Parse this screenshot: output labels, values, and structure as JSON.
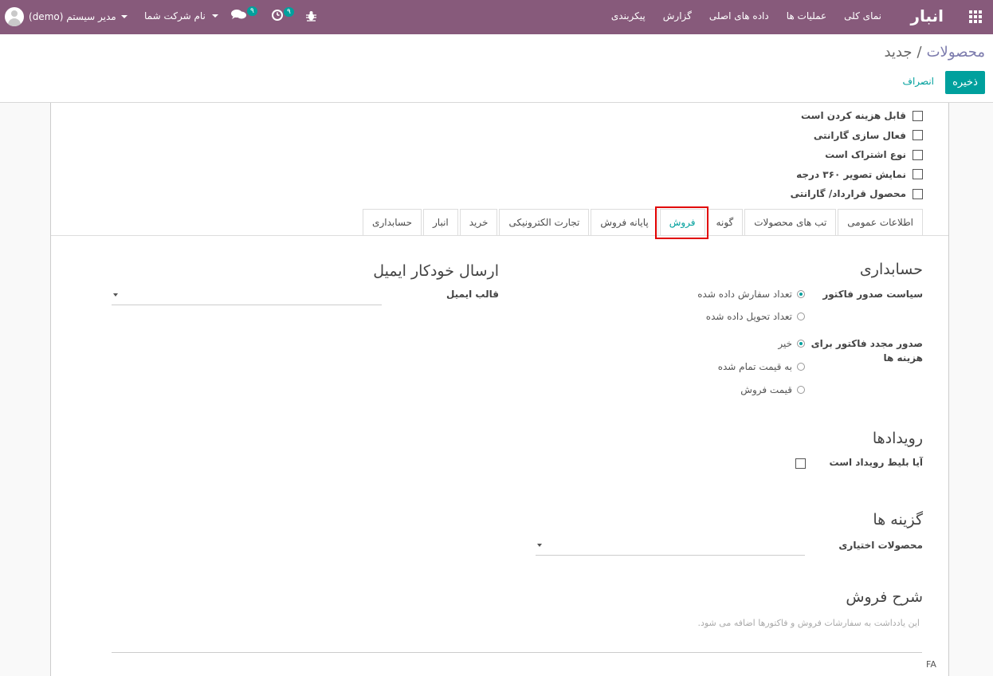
{
  "navbar": {
    "brand": "انبار",
    "menu": [
      "نمای کلی",
      "عملیات ها",
      "داده های اصلی",
      "گزارش",
      "پیکربندی"
    ],
    "user_name": "مدیر سیستم (demo)",
    "company": "نام شرکت شما",
    "messages_badge": "۹",
    "activities_badge": "۹",
    "icons": [
      "apps-icon",
      "chat-icon",
      "clock-icon",
      "bug-icon",
      "avatar"
    ]
  },
  "control_panel": {
    "breadcrumb_parent": "محصولات",
    "breadcrumb_sep": "/",
    "breadcrumb_current": "جدید",
    "save_label": "ذخیره",
    "discard_label": "انصراف"
  },
  "checkboxes": [
    "قابل هزینه کردن است",
    "فعال سازی گارانتی",
    "نوع اشتراک است",
    "نمایش تصویر ۳۶۰ درجه",
    "محصول قرارداد/ گارانتی"
  ],
  "tabs": [
    "اطلاعات عمومی",
    "تب های محصولات",
    "گونه",
    "فروش",
    "پایانه فروش",
    "تجارت الکترونیکی",
    "خرید",
    "انبار",
    "حسابداری"
  ],
  "active_tab": "فروش",
  "accounting": {
    "title": "حسابداری",
    "invoicing_policy_label": "سیاست صدور فاکتور",
    "invoicing_options": [
      "تعداد سفارش داده شده",
      "تعداد تحویل داده شده"
    ],
    "reinvoice_label_line1": "صدور مجدد فاکتور برای",
    "reinvoice_label_line2": "هزینه ها",
    "reinvoice_options": [
      "خیر",
      "به قیمت تمام شده",
      "قیمت فروش"
    ]
  },
  "email": {
    "title": "ارسال خودکار ایمیل",
    "template_label": "قالب ایمیل"
  },
  "events": {
    "title": "رویدادها",
    "ticket_label": "آیا بلیط رویداد است"
  },
  "options": {
    "title": "گزینه ها",
    "optional_products_label": "محصولات اختیاری"
  },
  "sales_description": {
    "title": "شرح فروش",
    "placeholder": "این یادداشت به سفارشات فروش و فاکتورها اضافه می شود."
  },
  "lang": "FA",
  "colors": {
    "navbar": "#875a7b",
    "accent": "#00a09d",
    "highlight": "#e10000"
  }
}
